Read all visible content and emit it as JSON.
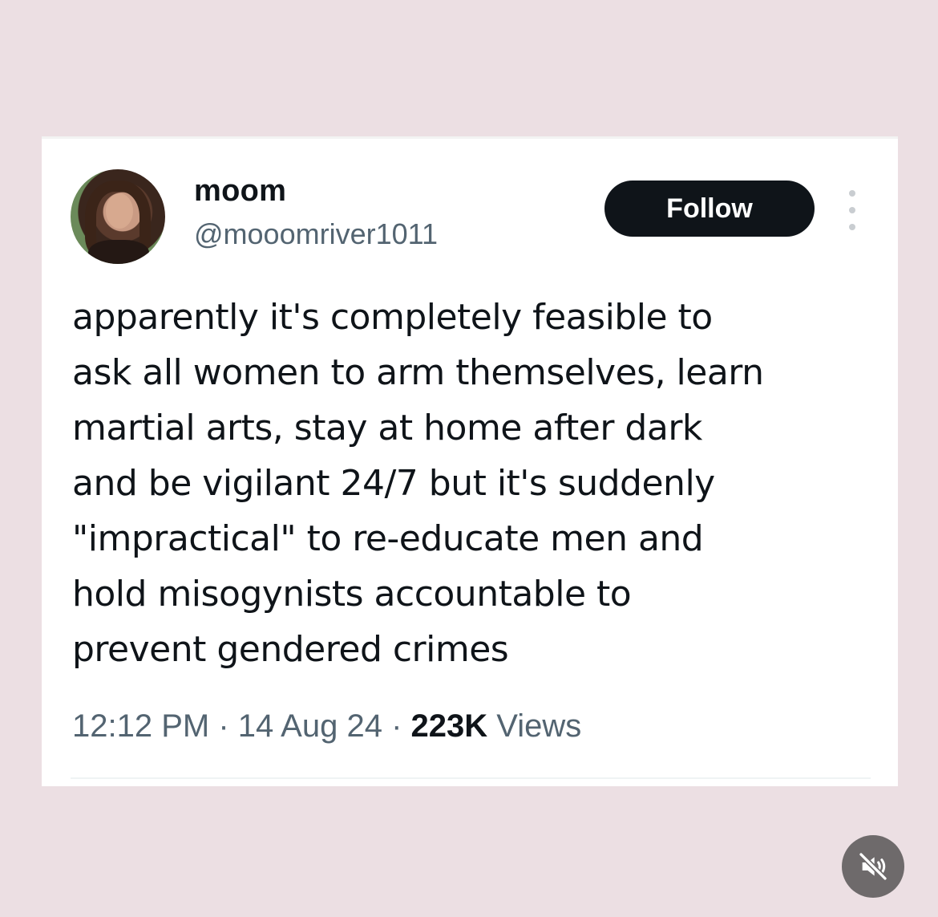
{
  "tweet": {
    "display_name": "moom",
    "handle": "@mooomriver1011",
    "follow_label": "Follow",
    "text": "apparently it's completely feasible to\nask all women to arm themselves, learn\nmartial arts, stay at home after dark\nand be vigilant 24/7 but it's suddenly\n\"impractical\" to re-educate men and\nhold misogynists accountable to\nprevent gendered crimes",
    "time": "12:12 PM",
    "date": "14 Aug 24",
    "separator": " · ",
    "views_count": "223K",
    "views_label": " Views"
  },
  "icons": {
    "more": "more-vertical-icon",
    "mute": "speaker-muted-icon",
    "avatar": "user-avatar"
  },
  "colors": {
    "background": "#ecdfe3",
    "card": "#ffffff",
    "text_primary": "#0f1419",
    "text_secondary": "#536471",
    "follow_button": "#0f1419"
  }
}
